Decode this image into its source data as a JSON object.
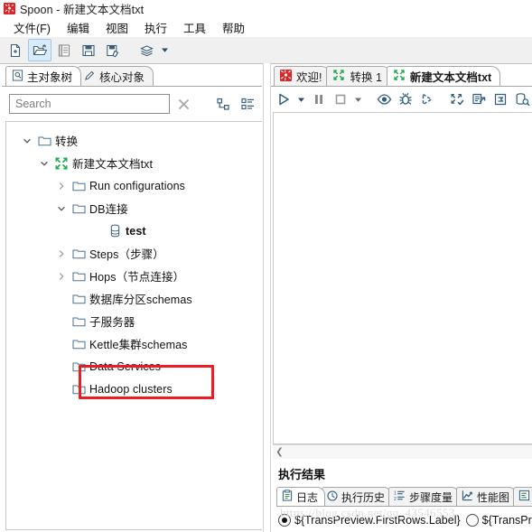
{
  "window": {
    "logo_icon": "spoon-logo-icon",
    "title": "Spoon - 新建文本文档txt"
  },
  "menubar": {
    "items": [
      {
        "label": "文件(F)",
        "name": "menu-file"
      },
      {
        "label": "编辑",
        "name": "menu-edit"
      },
      {
        "label": "视图",
        "name": "menu-view"
      },
      {
        "label": "执行",
        "name": "menu-run"
      },
      {
        "label": "工具",
        "name": "menu-tools"
      },
      {
        "label": "帮助",
        "name": "menu-help"
      }
    ]
  },
  "toolbar": {
    "buttons": [
      {
        "icon": "new-file-icon",
        "name": "new-file-button",
        "active": false
      },
      {
        "icon": "open-folder-icon",
        "name": "open-file-button",
        "active": true
      },
      {
        "icon": "explorer-list-icon",
        "name": "explore-repository-button",
        "active": false
      },
      {
        "icon": "save-icon",
        "name": "save-button",
        "active": false
      },
      {
        "icon": "save-as-icon",
        "name": "save-as-button",
        "active": false
      },
      {
        "icon": "layers-icon",
        "name": "print-layers-button",
        "active": false
      }
    ],
    "dropdown_caret": "▾"
  },
  "left_panel": {
    "tabs": [
      {
        "label": "主对象树",
        "icon": "document-search-icon",
        "name": "tab-main-object-tree",
        "active": true
      },
      {
        "label": "核心对象",
        "icon": "pencil-icon",
        "name": "tab-core-objects",
        "active": false
      }
    ],
    "search": {
      "value": "",
      "placeholder": "Search",
      "clear_icon": "close-x-icon",
      "collapse_icon": "collapse-tree-icon",
      "view_icon": "list-view-icon"
    },
    "tree": [
      {
        "label": "转换",
        "icon": "folder-icon",
        "twisty": "expanded",
        "indent": 0,
        "bold": false,
        "name": "tree-node-transformations"
      },
      {
        "label": "新建文本文档txt",
        "icon": "transformation-icon",
        "twisty": "expanded",
        "indent": 1,
        "bold": false,
        "name": "tree-node-new-text-document"
      },
      {
        "label": "Run configurations",
        "icon": "folder-icon",
        "twisty": "collapsed",
        "indent": 2,
        "bold": false,
        "name": "tree-node-run-configurations"
      },
      {
        "label": "DB连接",
        "icon": "folder-icon",
        "twisty": "expanded",
        "indent": 2,
        "bold": false,
        "name": "tree-node-db-connections"
      },
      {
        "label": "test",
        "icon": "database-icon",
        "twisty": "none",
        "indent": 3,
        "bold": true,
        "name": "tree-node-test-connection"
      },
      {
        "label": "Steps（步骤）",
        "icon": "folder-icon",
        "twisty": "collapsed",
        "indent": 2,
        "bold": false,
        "name": "tree-node-steps"
      },
      {
        "label": "Hops（节点连接）",
        "icon": "folder-icon",
        "twisty": "collapsed",
        "indent": 2,
        "bold": false,
        "name": "tree-node-hops"
      },
      {
        "label": "数据库分区schemas",
        "icon": "folder-icon",
        "twisty": "none",
        "indent": 2,
        "bold": false,
        "name": "tree-node-partition-schemas"
      },
      {
        "label": "子服务器",
        "icon": "folder-icon",
        "twisty": "none",
        "indent": 2,
        "bold": false,
        "name": "tree-node-slave-servers"
      },
      {
        "label": "Kettle集群schemas",
        "icon": "folder-icon",
        "twisty": "none",
        "indent": 2,
        "bold": false,
        "name": "tree-node-cluster-schemas"
      },
      {
        "label": "Data Services",
        "icon": "folder-icon",
        "twisty": "none",
        "indent": 2,
        "bold": false,
        "name": "tree-node-data-services"
      },
      {
        "label": "Hadoop clusters",
        "icon": "folder-icon",
        "twisty": "none",
        "indent": 2,
        "bold": false,
        "name": "tree-node-hadoop-clusters"
      }
    ],
    "annotation": {
      "color": "#ec1c24",
      "target": "Hadoop clusters"
    }
  },
  "right_panel": {
    "tabs": [
      {
        "label": "欢迎!",
        "icon": "spoon-logo-icon",
        "name": "tab-welcome",
        "active": false
      },
      {
        "label": "转换 1",
        "icon": "transformation-icon",
        "name": "tab-transformation-1",
        "active": false
      },
      {
        "label": "新建文本文档txt",
        "icon": "transformation-icon",
        "name": "tab-new-text-document",
        "active": true
      }
    ],
    "toolbar": [
      {
        "icon": "run-icon",
        "name": "run-button"
      },
      {
        "icon": "caret-down-icon",
        "name": "run-options-caret"
      },
      {
        "icon": "pause-icon",
        "name": "pause-button"
      },
      {
        "icon": "stop-icon",
        "name": "stop-button"
      },
      {
        "icon": "caret-down-icon",
        "name": "stop-options-caret"
      },
      {
        "icon": "preview-eye-icon",
        "name": "preview-button"
      },
      {
        "icon": "debug-bug-icon",
        "name": "debug-button"
      },
      {
        "icon": "replay-icon",
        "name": "replay-button"
      },
      {
        "icon": "verify-transformation-icon",
        "name": "verify-button"
      },
      {
        "icon": "impact-analysis-icon",
        "name": "impact-button"
      },
      {
        "icon": "sql-script-icon",
        "name": "sql-button"
      },
      {
        "icon": "database-explore-icon",
        "name": "db-explore-button"
      },
      {
        "icon": "show-grid-icon",
        "name": "grid-button"
      }
    ],
    "hscroll_left_icon": "chevron-left-icon"
  },
  "results": {
    "title": "执行结果",
    "tabs": [
      {
        "label": "日志",
        "icon": "clipboard-icon",
        "name": "results-tab-log",
        "active": true
      },
      {
        "label": "执行历史",
        "icon": "clock-icon",
        "name": "results-tab-history",
        "active": false
      },
      {
        "label": "步骤度量",
        "icon": "numbered-list-icon",
        "name": "results-tab-step-metrics",
        "active": false
      },
      {
        "label": "性能图",
        "icon": "line-chart-icon",
        "name": "results-tab-performance",
        "active": false
      },
      {
        "label": "",
        "icon": "metrics-icon",
        "name": "results-tab-metrics",
        "active": false
      }
    ],
    "options": [
      {
        "label": "${TransPreview.FirstRows.Label}",
        "selected": true,
        "name": "radio-first-rows"
      },
      {
        "label": "${TransPre",
        "selected": false,
        "name": "radio-last-rows"
      }
    ]
  },
  "watermark": {
    "text": "https://blog.csdn.net/qq_43546553"
  }
}
